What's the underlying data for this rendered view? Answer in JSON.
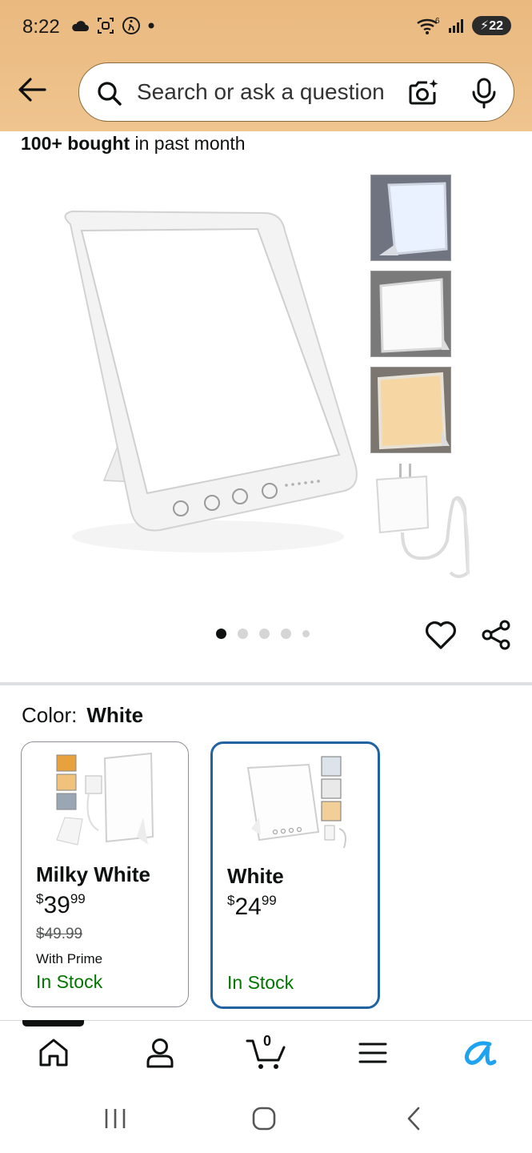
{
  "status_bar": {
    "time": "8:22",
    "signal_sup": "6",
    "battery": "22"
  },
  "search": {
    "placeholder": "Search or ask a question"
  },
  "product": {
    "bought_bold": "100+ bought",
    "bought_rest": " in past month",
    "image_count": 5,
    "active_image_index": 0
  },
  "color_selector": {
    "label": "Color:",
    "selected": "White",
    "options": [
      {
        "name": "Milky White",
        "price_whole": "39",
        "price_fraction": "99",
        "currency": "$",
        "list_price": "$49.99",
        "prime": "With Prime",
        "stock": "In Stock",
        "selected": false
      },
      {
        "name": "White",
        "price_whole": "24",
        "price_fraction": "99",
        "currency": "$",
        "stock": "In Stock",
        "selected": true
      }
    ]
  },
  "bottom_tabs": {
    "cart_count": "0"
  },
  "colors": {
    "header": "#f0c48f",
    "in_stock": "#007600",
    "selected_border": "#2162a1",
    "alexa": "#1ea3f0"
  }
}
